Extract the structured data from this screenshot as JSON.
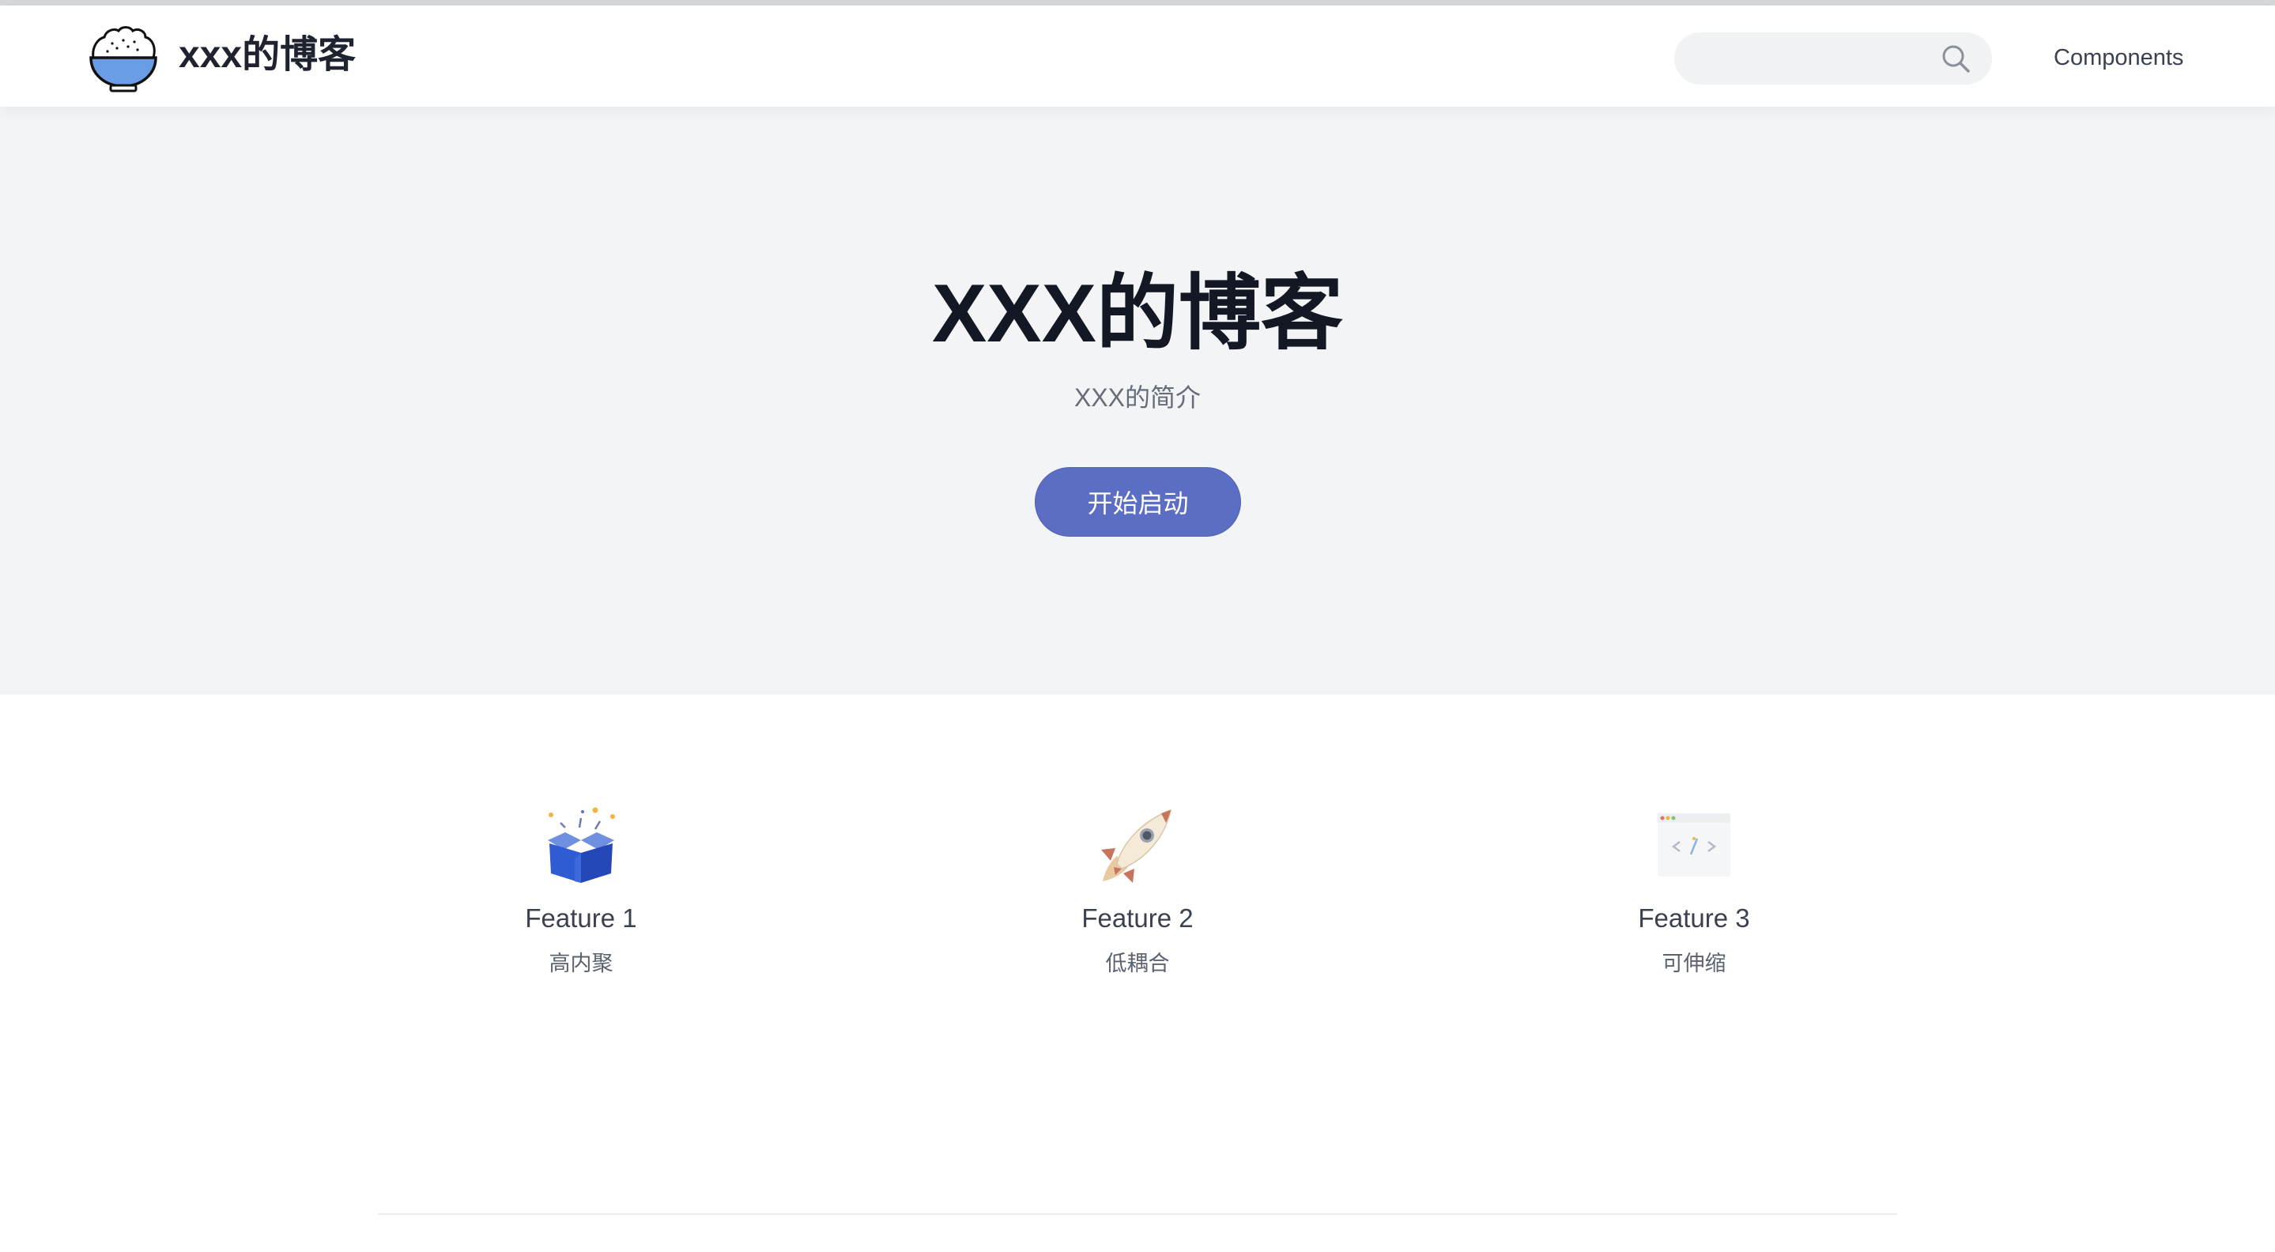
{
  "header": {
    "site_name": "xxx的博客",
    "search": {
      "value": "",
      "placeholder": ""
    },
    "nav_links": [
      "Components"
    ]
  },
  "hero": {
    "title": "XXX的博客",
    "description": "XXX的简介",
    "action_label": "开始启动"
  },
  "features": [
    {
      "icon": "open-box-icon",
      "title": "Feature 1",
      "description": "高内聚"
    },
    {
      "icon": "rocket-icon",
      "title": "Feature 2",
      "description": "低耦合"
    },
    {
      "icon": "code-window-icon",
      "title": "Feature 3",
      "description": "可伸缩"
    }
  ],
  "colors": {
    "accent": "#5b6ec4",
    "hero_background": "#f3f4f6",
    "logo_fill": "#6a9de6"
  }
}
